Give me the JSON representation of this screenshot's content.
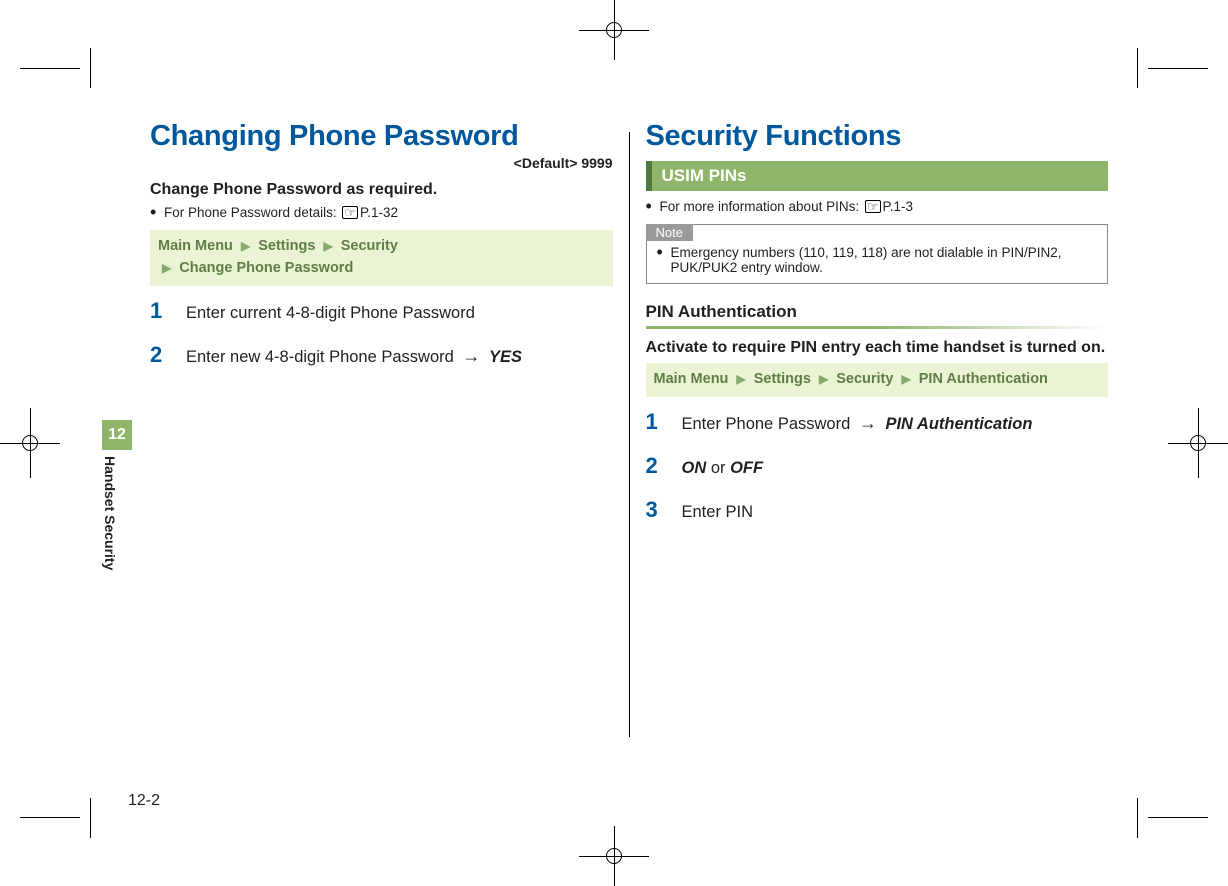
{
  "side": {
    "chapter_num": "12",
    "chapter_label": "Handset Security"
  },
  "page_number": "12-2",
  "left": {
    "title": "Changing Phone Password",
    "default_label": "<Default> 9999",
    "lead": "Change Phone Password as required.",
    "detail_text": "For Phone Password details: ",
    "detail_ref": "P.1-32",
    "nav": {
      "a": "Main Menu",
      "b": "Settings",
      "c": "Security",
      "d": "Change Phone Password"
    },
    "steps": {
      "s1": "Enter current 4-8-digit Phone Password",
      "s2_pre": "Enter new 4-8-digit Phone Password ",
      "s2_strong": "YES"
    }
  },
  "right": {
    "title": "Security Functions",
    "bar": "USIM PINs",
    "info_text": "For more information about PINs: ",
    "info_ref": "P.1-3",
    "note_label": "Note",
    "note_body": "Emergency numbers (110, 119, 118) are not dialable in PIN/PIN2, PUK/PUK2 entry window.",
    "subhead": "PIN Authentication",
    "lead": "Activate to require PIN entry each time handset is turned on.",
    "nav": {
      "a": "Main Menu",
      "b": "Settings",
      "c": "Security",
      "d": "PIN Authentication"
    },
    "steps": {
      "s1_pre": "Enter Phone Password ",
      "s1_strong": "PIN Authentication",
      "s2_on": "ON",
      "s2_mid": " or ",
      "s2_off": "OFF",
      "s3": "Enter PIN"
    }
  }
}
